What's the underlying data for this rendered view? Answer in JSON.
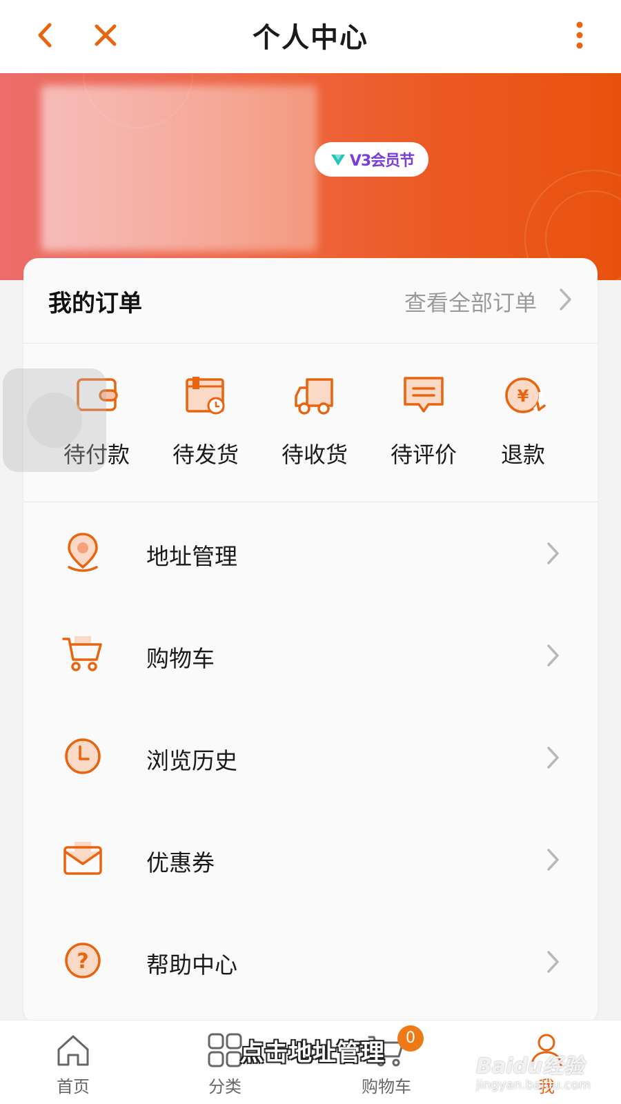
{
  "colors": {
    "accent": "#e8640f",
    "banner_start": "#ec6d6a",
    "banner_end": "#e8520e",
    "vip_text": "#7a3dd8"
  },
  "header": {
    "title": "个人中心",
    "back_icon": "chevron-left-icon",
    "close_icon": "close-icon",
    "more_icon": "vertical-dots-icon"
  },
  "banner": {
    "vip_badge": "V3会员节"
  },
  "orders": {
    "title": "我的订单",
    "view_all": "查看全部订单",
    "items": [
      {
        "label": "待付款",
        "icon": "wallet-icon"
      },
      {
        "label": "待发货",
        "icon": "package-clock-icon"
      },
      {
        "label": "待收货",
        "icon": "truck-icon"
      },
      {
        "label": "待评价",
        "icon": "comment-icon"
      },
      {
        "label": "退款",
        "icon": "refund-yen-icon"
      }
    ]
  },
  "menu": [
    {
      "label": "地址管理",
      "icon": "location-pin-icon"
    },
    {
      "label": "购物车",
      "icon": "cart-icon"
    },
    {
      "label": "浏览历史",
      "icon": "clock-icon"
    },
    {
      "label": "优惠券",
      "icon": "coupon-envelope-icon"
    },
    {
      "label": "帮助中心",
      "icon": "help-icon"
    }
  ],
  "tabbar": {
    "items": [
      {
        "label": "首页",
        "icon": "home-icon"
      },
      {
        "label": "分类",
        "icon": "grid-icon"
      },
      {
        "label": "购物车",
        "icon": "cart-icon",
        "badge": "0"
      },
      {
        "label": "我",
        "icon": "user-icon",
        "active": true
      }
    ]
  },
  "overlay": {
    "caption": "点击地址管理",
    "watermark_main": "Baidu经验",
    "watermark_sub": "jingyan.baidu.com"
  }
}
